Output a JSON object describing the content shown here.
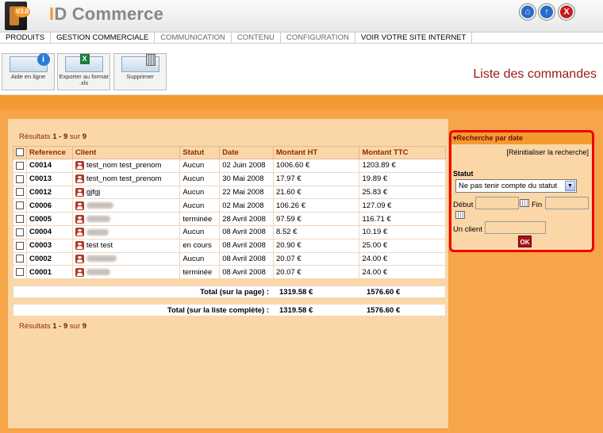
{
  "app": {
    "logo_badge": "V3.0",
    "title_prefix": "I",
    "title_rest": "D Commerce"
  },
  "window_buttons": [
    {
      "name": "home-icon",
      "glyph": "⌂",
      "color": "#2a6ac8"
    },
    {
      "name": "info-icon",
      "glyph": "↑",
      "color": "#2a6ac8"
    },
    {
      "name": "close-icon",
      "glyph": "X",
      "color": "#c81a1a"
    }
  ],
  "menu": [
    {
      "label": "PRODUITS",
      "active": true
    },
    {
      "label": "GESTION COMMERCIALE",
      "active": true
    },
    {
      "label": "COMMUNICATION",
      "active": false
    },
    {
      "label": "CONTENU",
      "active": false
    },
    {
      "label": "CONFIGURATION",
      "active": false
    },
    {
      "label": "VOIR VOTRE SITE INTERNET",
      "active": true
    }
  ],
  "toolbar": {
    "help": "Aide en ligne",
    "export": "Exporter au format .xls",
    "delete": "Supprimer"
  },
  "page_title": "Liste des commandes",
  "results": {
    "prefix": "Résultats",
    "range": "1 - 9",
    "of": "sur",
    "total": "9"
  },
  "table": {
    "headers": [
      "Reference",
      "Client",
      "Statut",
      "Date",
      "Montant HT",
      "Montant TTC"
    ],
    "rows": [
      {
        "ref": "C0014",
        "client": "test_nom test_prenom",
        "blurred": false,
        "statut": "Aucun",
        "date": "02 Juin 2008",
        "ht": "1006.60 €",
        "ttc": "1203.89 €"
      },
      {
        "ref": "C0013",
        "client": "test_nom test_prenom",
        "blurred": false,
        "statut": "Aucun",
        "date": "30 Mai 2008",
        "ht": "17.97 €",
        "ttc": "19.89 €"
      },
      {
        "ref": "C0012",
        "client": "gjfgj",
        "blurred": false,
        "statut": "Aucun",
        "date": "22 Mai 2008",
        "ht": "21.60 €",
        "ttc": "25.83 €"
      },
      {
        "ref": "C0006",
        "client": "",
        "blurred": true,
        "statut": "Aucun",
        "date": "02 Mai 2008",
        "ht": "106.26 €",
        "ttc": "127.09 €"
      },
      {
        "ref": "C0005",
        "client": "",
        "blurred": true,
        "statut": "terminée",
        "date": "28 Avril 2008",
        "ht": "97.59 €",
        "ttc": "116.71 €"
      },
      {
        "ref": "C0004",
        "client": "",
        "blurred": true,
        "statut": "Aucun",
        "date": "08 Avril 2008",
        "ht": "8.52 €",
        "ttc": "10.19 €"
      },
      {
        "ref": "C0003",
        "client": "test test",
        "blurred": false,
        "statut": "en cours",
        "date": "08 Avril 2008",
        "ht": "20.90 €",
        "ttc": "25.00 €"
      },
      {
        "ref": "C0002",
        "client": "",
        "blurred": true,
        "statut": "Aucun",
        "date": "08 Avril 2008",
        "ht": "20.07 €",
        "ttc": "24.00 €"
      },
      {
        "ref": "C0001",
        "client": "",
        "blurred": true,
        "statut": "terminée",
        "date": "08 Avril 2008",
        "ht": "20.07 €",
        "ttc": "24.00 €"
      }
    ],
    "total_page": {
      "label": "Total (sur la page) :",
      "ht": "1319.58 €",
      "ttc": "1576.60 €"
    },
    "total_all": {
      "label": "Total (sur la liste complète) :",
      "ht": "1319.58 €",
      "ttc": "1576.60 €"
    }
  },
  "search": {
    "title": "▾Recherche par date",
    "reset": "[Réinitialiser la recherche]",
    "statut_label": "Statut",
    "statut_value": "Ne pas tenir compte du statut",
    "debut_label": "Début",
    "fin_label": "Fin",
    "client_label": "Un client",
    "ok": "OK"
  }
}
